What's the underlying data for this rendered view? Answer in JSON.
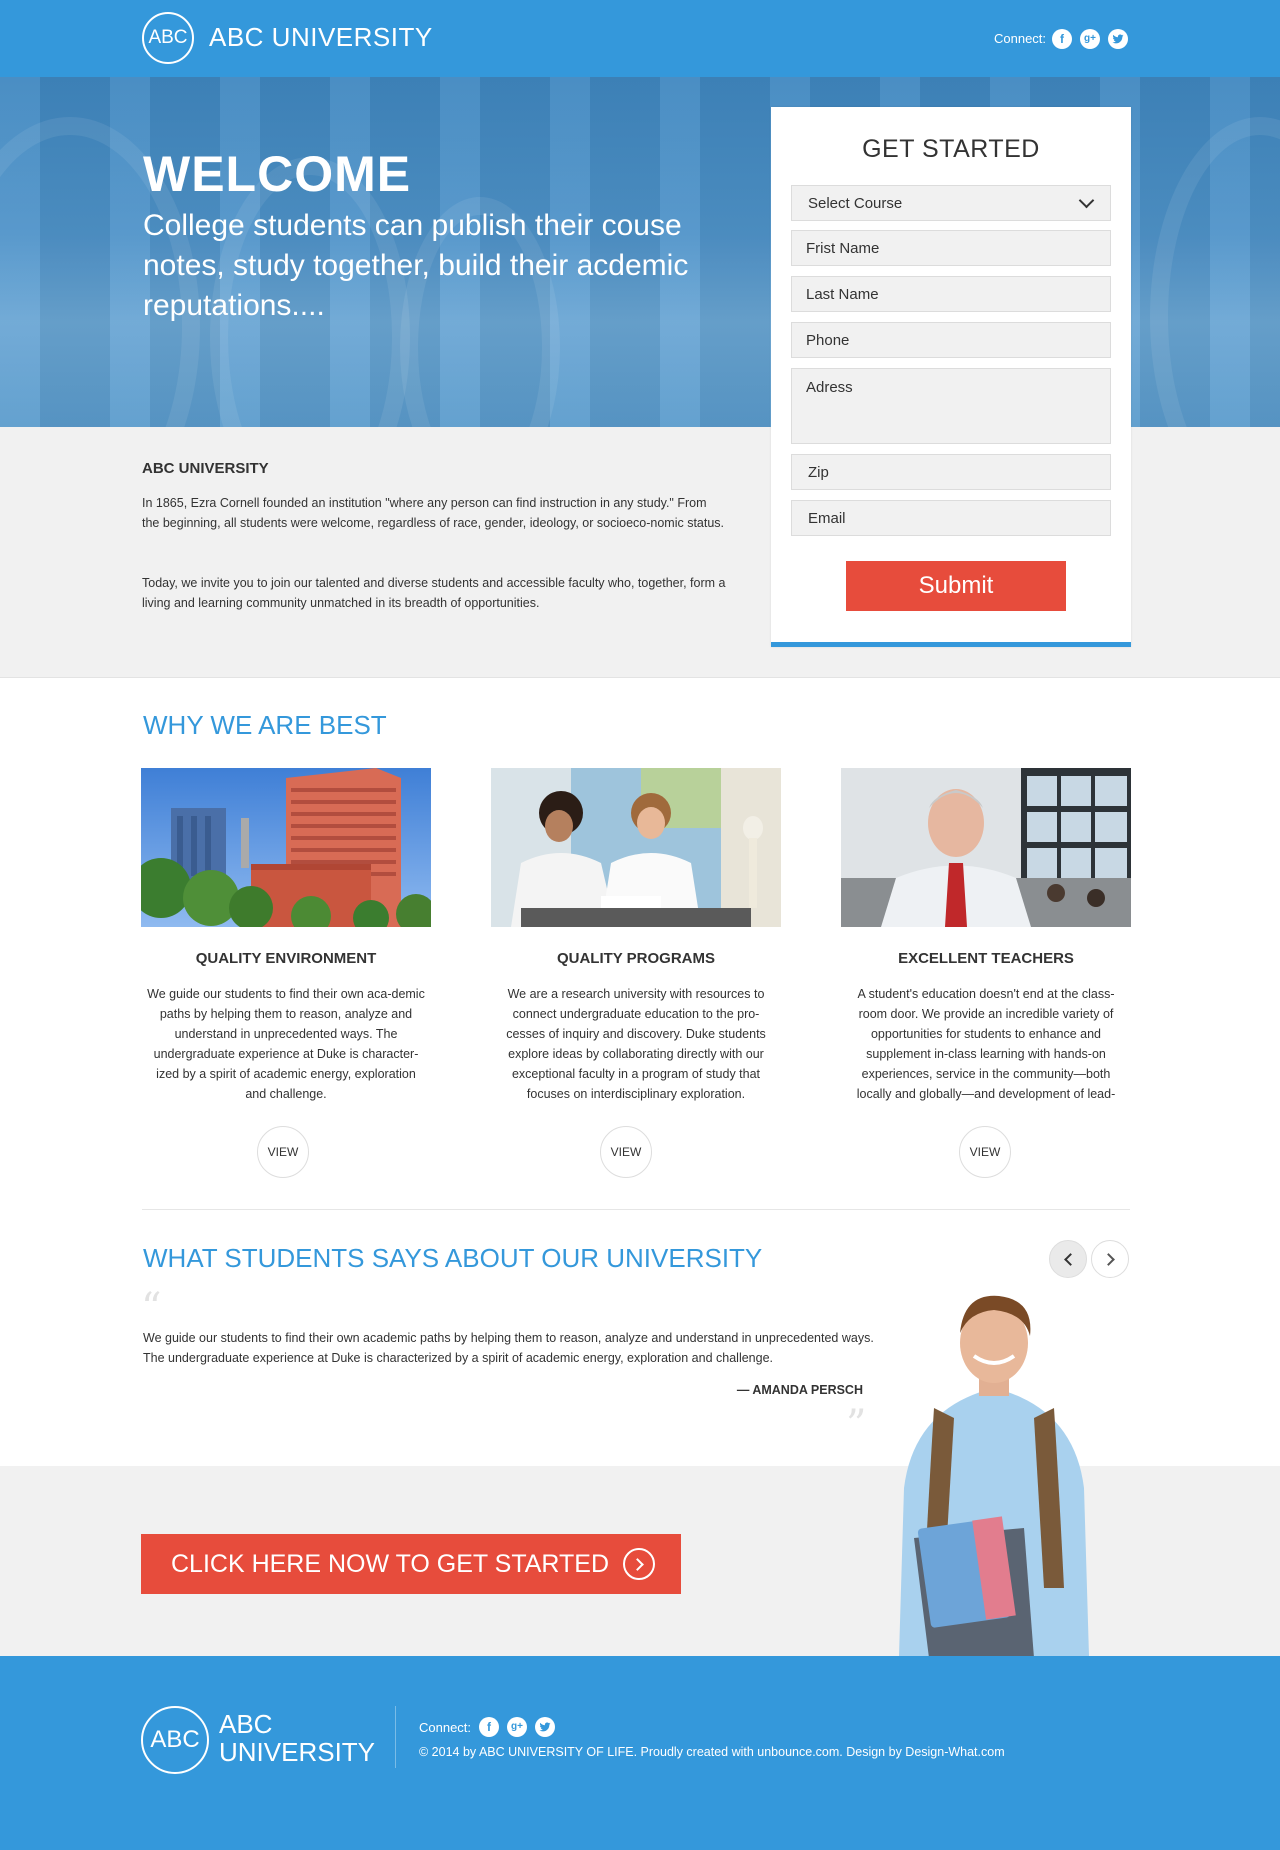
{
  "header": {
    "logo_text": "ABC",
    "brand": "ABC UNIVERSITY",
    "connect_label": "Connect:",
    "social": [
      {
        "name": "facebook-icon",
        "glyph": "f"
      },
      {
        "name": "google-plus-icon",
        "glyph": "g+"
      },
      {
        "name": "twitter-icon",
        "glyph": "t"
      }
    ]
  },
  "hero": {
    "title": "WELCOME",
    "subtitle": "College students can publish their couse notes, study together, build their acdemic reputations...."
  },
  "form": {
    "title": "GET STARTED",
    "course_select": "Select Course",
    "first_name_placeholder": "Frist Name",
    "last_name_placeholder": "Last Name",
    "phone_placeholder": "Phone",
    "address_placeholder": "Adress",
    "zip_placeholder": "Zip",
    "email_placeholder": "Email",
    "submit_label": "Submit"
  },
  "about": {
    "title": "ABC UNIVERSITY",
    "paragraph1": "In 1865, Ezra Cornell founded an institution \"where any person can find instruction in any study.\" From the beginning, all students were welcome, regardless of race, gender, ideology, or socioeco-nomic status.",
    "paragraph2": "Today, we invite you to join our talented and diverse students and accessible faculty who, together, form a living and learning community unmatched in its breadth of opportunities."
  },
  "why": {
    "title": "WHY WE ARE BEST",
    "cards": [
      {
        "title": "QUALITY ENVIRONMENT",
        "text": "We guide our students to find their own aca-demic paths by helping them to reason, analyze and understand in unprecedented ways. The undergraduate experience at Duke is character-ized by a spirit of academic energy, exploration and challenge.",
        "button": "VIEW"
      },
      {
        "title": "QUALITY PROGRAMS",
        "text": "We are a research university with resources to connect undergraduate education to the pro-cesses of inquiry and discovery. Duke students explore ideas by collaborating directly with our exceptional faculty in a program of study that focuses on interdisciplinary exploration.",
        "button": "VIEW"
      },
      {
        "title": "EXCELLENT TEACHERS",
        "text": "A student's education doesn't end at the class-room door. We provide an incredible variety of opportunities for students to enhance and supplement in-class learning with hands-on experiences, service in the community—both locally and globally—and development of lead-",
        "button": "VIEW"
      }
    ]
  },
  "testimonials": {
    "title": "WHAT STUDENTS SAYS ABOUT OUR UNIVERSITY",
    "quote": "We guide our students to find their own academic paths by helping them to reason, analyze and understand in unprecedented ways. The undergraduate experience at Duke is characterized by a spirit of academic energy, exploration and challenge.",
    "author": "— AMANDA PERSCH"
  },
  "cta": {
    "label": "CLICK HERE NOW TO GET STARTED"
  },
  "footer": {
    "logo_text": "ABC",
    "brand_line1": "ABC",
    "brand_line2": "UNIVERSITY",
    "connect_label": "Connect:",
    "copyright": "© 2014 by ABC UNIVERSITY OF LIFE. Proudly created with unbounce.com. Design by Design-What.com"
  },
  "colors": {
    "primary_blue": "#3498db",
    "accent_red": "#e74c3c",
    "band_gray": "#f1f1f1"
  }
}
